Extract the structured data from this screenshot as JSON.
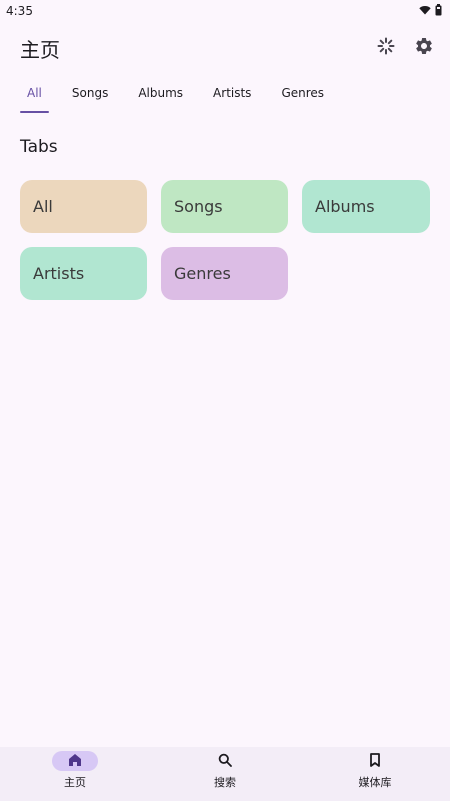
{
  "status": {
    "time": "4:35",
    "wifi_icon": "wifi-icon",
    "battery_icon": "battery-icon"
  },
  "app_bar": {
    "title": "主页",
    "actions": [
      {
        "icon": "shuffle-icon"
      },
      {
        "icon": "gear-icon"
      }
    ]
  },
  "tabs": {
    "items": [
      "All",
      "Songs",
      "Albums",
      "Artists",
      "Genres"
    ],
    "active_index": 0,
    "accent_color": "#6750a4"
  },
  "section": {
    "title": "Tabs"
  },
  "chips": [
    {
      "label": "All",
      "color": "#ecd7bd"
    },
    {
      "label": "Songs",
      "color": "#bfe7c3"
    },
    {
      "label": "Albums",
      "color": "#b1e6d1"
    },
    {
      "label": "Artists",
      "color": "#b1e6d1"
    },
    {
      "label": "Genres",
      "color": "#dcbde5"
    }
  ],
  "bottom_nav": {
    "items": [
      {
        "label": "主页",
        "icon": "home-icon",
        "active": true
      },
      {
        "label": "搜索",
        "icon": "search-icon",
        "active": false
      },
      {
        "label": "媒体库",
        "icon": "bookmark-icon",
        "active": false
      }
    ],
    "active_pill_color": "#d7c8f5"
  }
}
